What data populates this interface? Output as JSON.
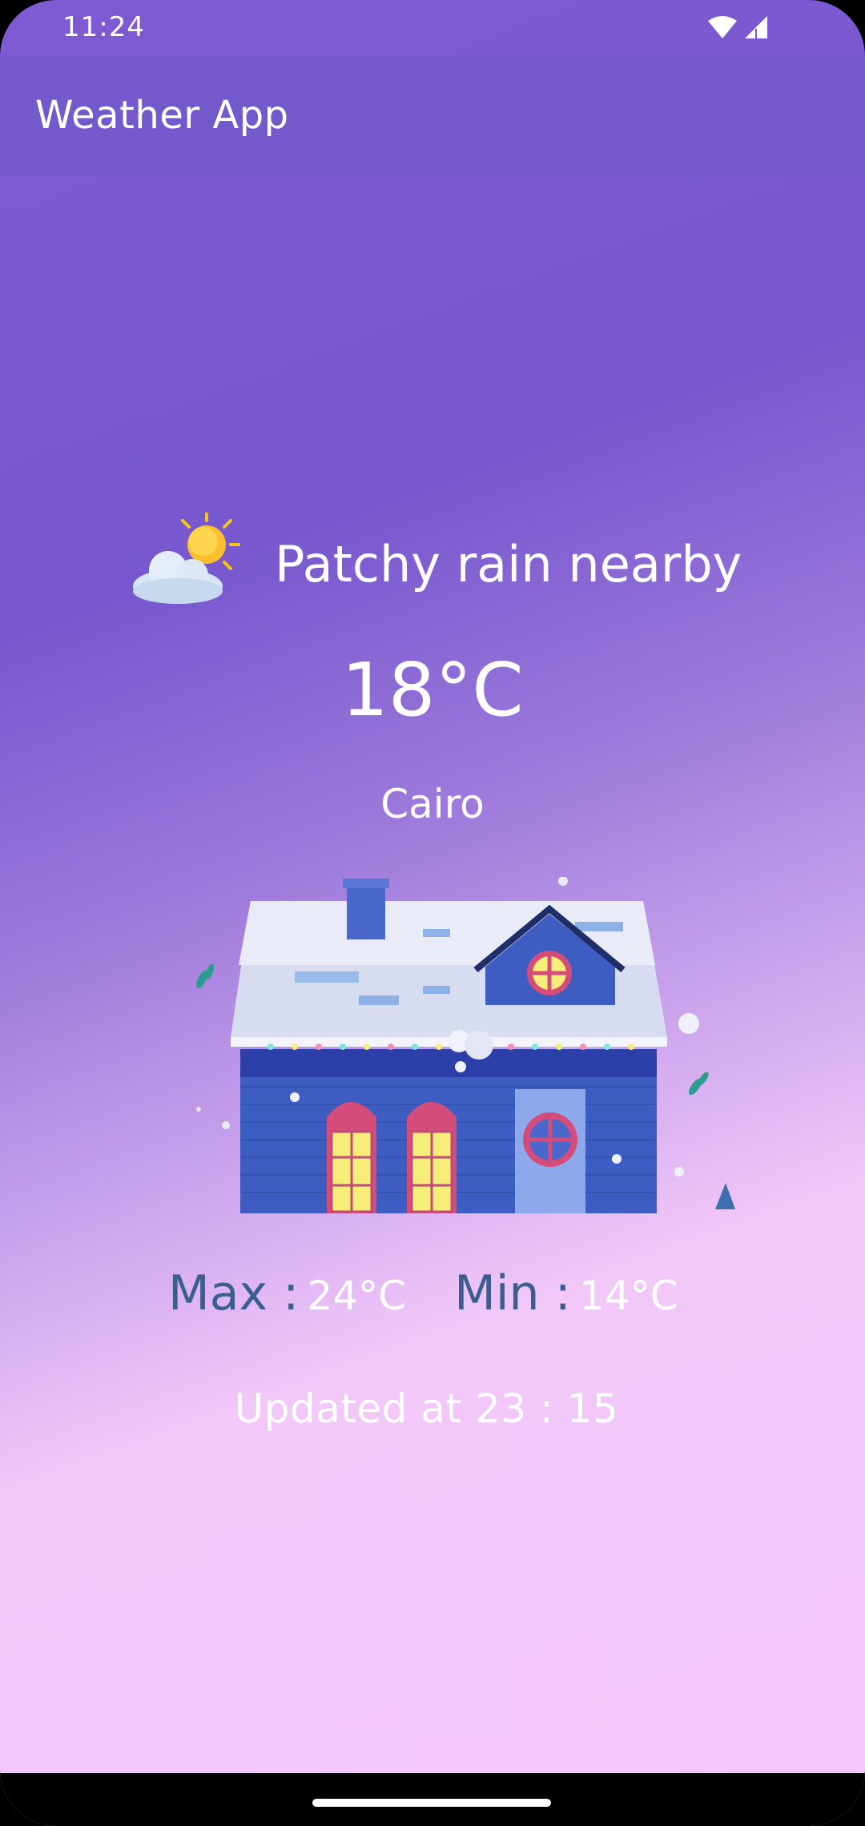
{
  "status_bar": {
    "time": "11:24",
    "icons": [
      "wifi-icon",
      "cellular-signal-icon"
    ]
  },
  "app_bar": {
    "title": "Weather App",
    "color": "#7359CC"
  },
  "weather": {
    "condition_icon": "partly-cloudy-sun-icon",
    "condition": "Patchy rain nearby",
    "temperature": "18°C",
    "city": "Cairo",
    "illustration": "snowy-house-illustration",
    "max_label": "Max :",
    "max_value": "24°C",
    "min_label": "Min :",
    "min_value": "14°C",
    "updated": "Updated at 23 : 15"
  },
  "colors": {
    "gradient_top": "#7758CE",
    "gradient_bottom": "#F3C6FB",
    "label_blue": "#3B5E8F",
    "text": "#FFFFFF"
  }
}
